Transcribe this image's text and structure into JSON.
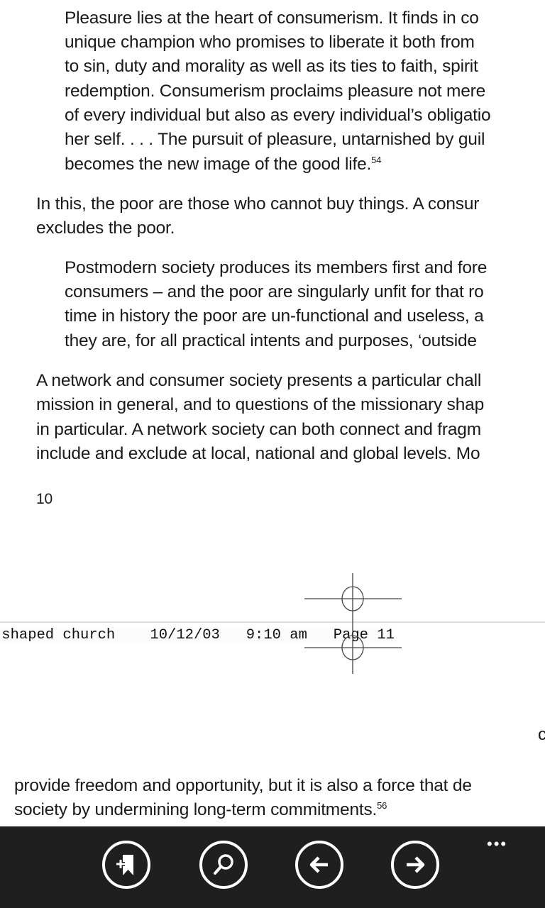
{
  "document": {
    "quote1": [
      "Pleasure lies at the heart of consumerism. It finds in co",
      "unique champion who promises to liberate it both from",
      "to sin, duty and morality as well as its ties to faith, spirit",
      "redemption. Consumerism proclaims pleasure not mere",
      "of every individual but also as every individual’s obligatio",
      "her self. . . . The pursuit of pleasure, untarnished by guil",
      "becomes the new image of the good life."
    ],
    "quote1_note": "54",
    "para1": [
      "In this, the poor are those who cannot buy things. A consur",
      "excludes the poor."
    ],
    "quote2": [
      "Postmodern society produces its members first and fore",
      "consumers – and the poor are singularly unfit for that ro",
      "time in history the poor are un-functional and useless, a",
      "they are, for all practical intents and purposes, ‘outside"
    ],
    "para2": [
      "A network and consumer society presents a particular chall",
      "mission in general, and to questions of the missionary shap",
      "in particular. A network society can both connect and fragm",
      "include and exclude at local, national and global levels. Mo"
    ],
    "page_number": "10",
    "print_header": "-shaped church    10/12/03   9:10 am   Page 11",
    "edge_fragment": "c",
    "para3": [
      "provide freedom and opportunity, but it is also a force that de",
      "society by undermining long-term commitments."
    ],
    "para3_note": "56"
  },
  "appbar": {
    "buttons": [
      {
        "icon": "add-bookmark-icon"
      },
      {
        "icon": "search-icon"
      },
      {
        "icon": "back-arrow-icon"
      },
      {
        "icon": "forward-arrow-icon"
      }
    ],
    "more": "•••",
    "background": "#1f1f1f"
  }
}
